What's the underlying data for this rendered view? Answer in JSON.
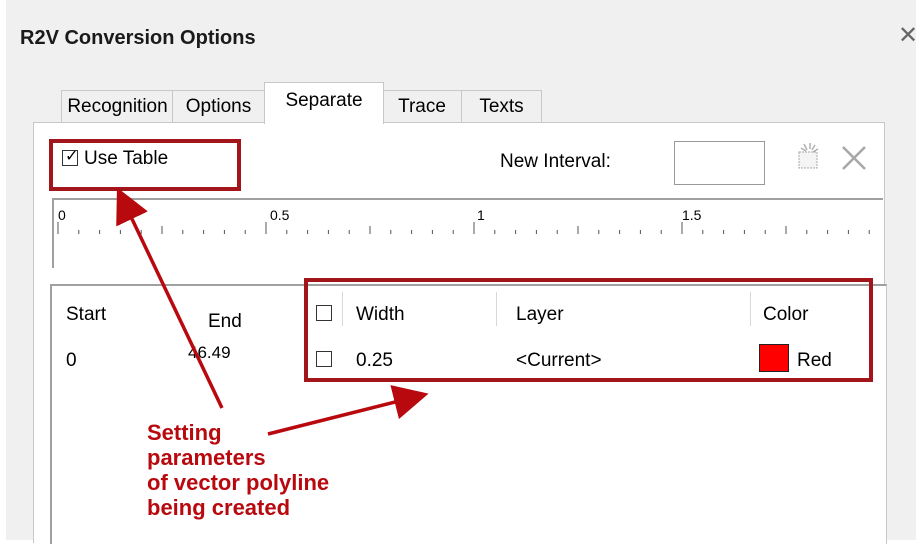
{
  "window": {
    "title": "R2V Conversion Options"
  },
  "tabs": [
    {
      "label": "Recognition",
      "active": false
    },
    {
      "label": "Options",
      "active": false
    },
    {
      "label": "Separate",
      "active": true
    },
    {
      "label": "Trace",
      "active": false
    },
    {
      "label": "Texts",
      "active": false
    }
  ],
  "separate": {
    "use_table_label": "Use Table",
    "use_table_checked": true,
    "new_interval_label": "New Interval:",
    "new_interval_value": "",
    "ruler_labels": [
      "0",
      "0.5",
      "1",
      "1.5"
    ],
    "table": {
      "headers": {
        "start": "Start",
        "end": "End",
        "width": "Width",
        "layer": "Layer",
        "color": "Color"
      },
      "rows": [
        {
          "start": "0",
          "end": "46.49",
          "checked": false,
          "width": "0.25",
          "layer": "<Current>",
          "color_name": "Red",
          "color_hex": "#ff0000"
        }
      ]
    }
  },
  "annotation": {
    "line1": "Setting",
    "line2": "parameters",
    "line3": "of vector polyline",
    "line4": "being created",
    "color": "#b8090f"
  },
  "colors": {
    "highlight_border": "#a1151b",
    "dialog_bg": "#f0f0f0"
  }
}
